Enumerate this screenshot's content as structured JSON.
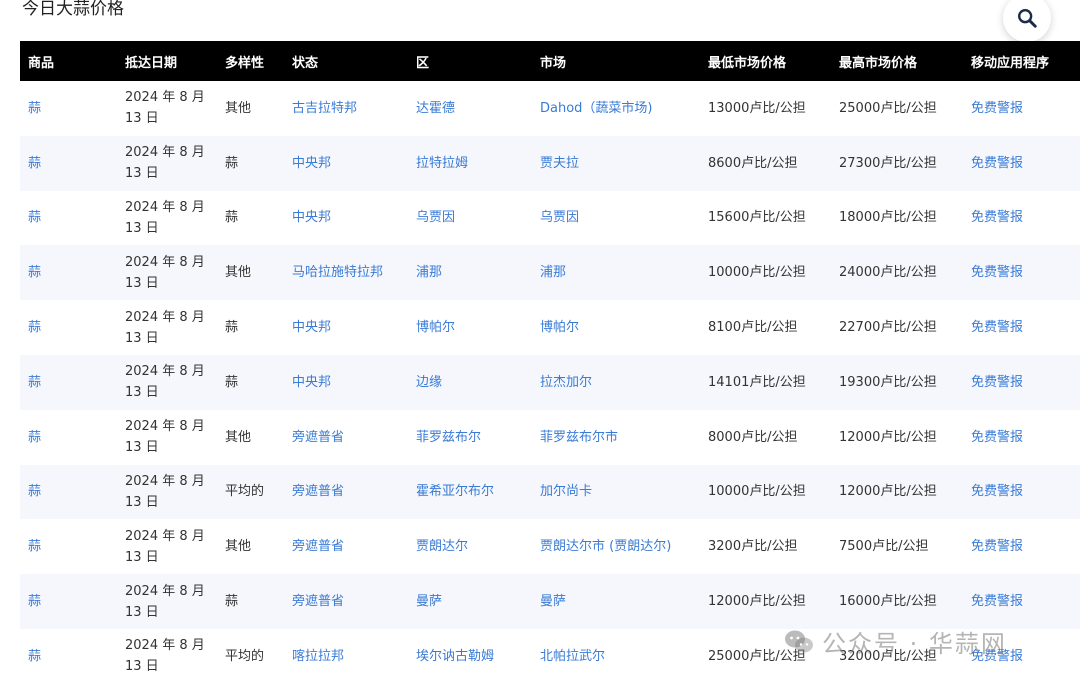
{
  "page": {
    "title": "今日大蒜价格"
  },
  "search": {
    "icon": "search-icon"
  },
  "table": {
    "headers": [
      "商品",
      "抵达日期",
      "多样性",
      "状态",
      "区",
      "市场",
      "最低市场价格",
      "最高市场价格",
      "移动应用程序"
    ],
    "rows": [
      {
        "commodity": "蒜",
        "date1": "2024 年 8 月",
        "date2": "13 日",
        "variety": "其他",
        "state": "古吉拉特邦",
        "district": "达霍德",
        "market": "Dahod（蔬菜市场)",
        "min": "13000卢比/公担",
        "max": "25000卢比/公担",
        "app": "免费警报"
      },
      {
        "commodity": "蒜",
        "date1": "2024 年 8 月",
        "date2": "13 日",
        "variety": "蒜",
        "state": "中央邦",
        "district": "拉特拉姆",
        "market": "贾夫拉",
        "min": "8600卢比/公担",
        "max": "27300卢比/公担",
        "app": "免费警报"
      },
      {
        "commodity": "蒜",
        "date1": "2024 年 8 月",
        "date2": "13 日",
        "variety": "蒜",
        "state": "中央邦",
        "district": "乌贾因",
        "market": "乌贾因",
        "min": "15600卢比/公担",
        "max": "18000卢比/公担",
        "app": "免费警报"
      },
      {
        "commodity": "蒜",
        "date1": "2024 年 8 月",
        "date2": "13 日",
        "variety": "其他",
        "state": "马哈拉施特拉邦",
        "district": "浦那",
        "market": "浦那",
        "min": "10000卢比/公担",
        "max": "24000卢比/公担",
        "app": "免费警报"
      },
      {
        "commodity": "蒜",
        "date1": "2024 年 8 月",
        "date2": "13 日",
        "variety": "蒜",
        "state": "中央邦",
        "district": "博帕尔",
        "market": "博帕尔",
        "min": "8100卢比/公担",
        "max": "22700卢比/公担",
        "app": "免费警报"
      },
      {
        "commodity": "蒜",
        "date1": "2024 年 8 月",
        "date2": "13 日",
        "variety": "蒜",
        "state": "中央邦",
        "district": "边缘",
        "market": "拉杰加尔",
        "min": "14101卢比/公担",
        "max": "19300卢比/公担",
        "app": "免费警报"
      },
      {
        "commodity": "蒜",
        "date1": "2024 年 8 月",
        "date2": "13 日",
        "variety": "其他",
        "state": "旁遮普省",
        "district": "菲罗兹布尔",
        "market": "菲罗兹布尔市",
        "min": "8000卢比/公担",
        "max": "12000卢比/公担",
        "app": "免费警报"
      },
      {
        "commodity": "蒜",
        "date1": "2024 年 8 月",
        "date2": "13 日",
        "variety": "平均的",
        "state": "旁遮普省",
        "district": "霍希亚尔布尔",
        "market": "加尔尚卡",
        "min": "10000卢比/公担",
        "max": "12000卢比/公担",
        "app": "免费警报"
      },
      {
        "commodity": "蒜",
        "date1": "2024 年 8 月",
        "date2": "13 日",
        "variety": "其他",
        "state": "旁遮普省",
        "district": "贾朗达尔",
        "market": "贾朗达尔市 (贾朗达尔)",
        "min": "3200卢比/公担",
        "max": "7500卢比/公担",
        "app": "免费警报"
      },
      {
        "commodity": "蒜",
        "date1": "2024 年 8 月",
        "date2": "13 日",
        "variety": "蒜",
        "state": "旁遮普省",
        "district": "曼萨",
        "market": "曼萨",
        "min": "12000卢比/公担",
        "max": "16000卢比/公担",
        "app": "免费警报"
      },
      {
        "commodity": "蒜",
        "date1": "2024 年 8 月",
        "date2": "13 日",
        "variety": "平均的",
        "state": "喀拉拉邦",
        "district": "埃尔讷古勒姆",
        "market": "北帕拉武尔",
        "min": "25000卢比/公担",
        "max": "32000卢比/公担",
        "app": "免费警报"
      }
    ]
  },
  "watermark": {
    "text": "公众号 · 华蒜网",
    "icon": "wechat-icon"
  }
}
